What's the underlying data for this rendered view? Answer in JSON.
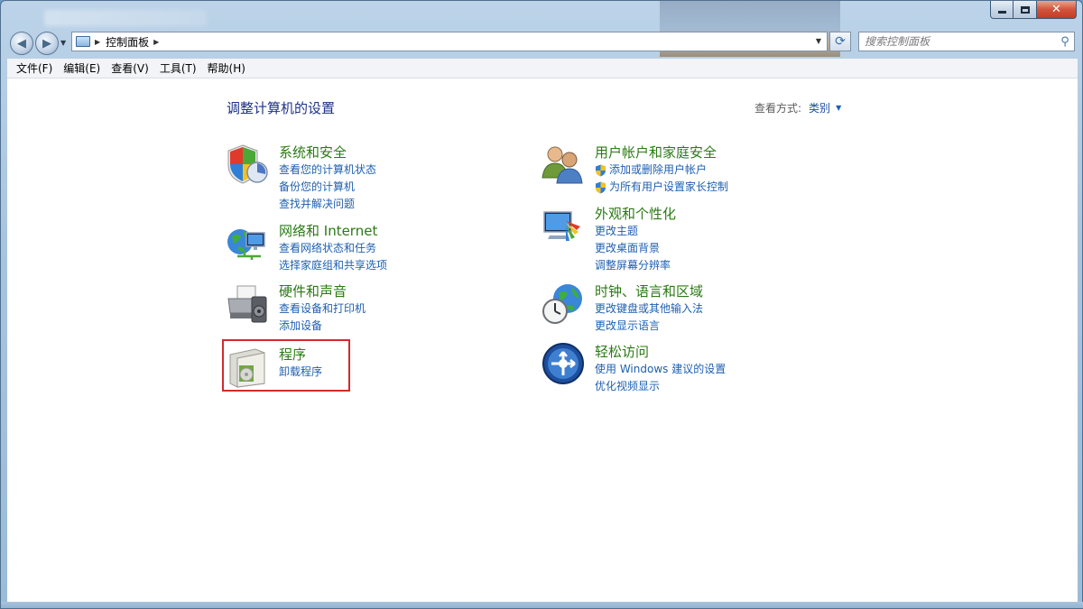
{
  "window": {
    "caption": {
      "minimize": "minimize",
      "maximize": "maximize",
      "close": "close"
    }
  },
  "nav": {
    "address": {
      "segment": "控制面板"
    },
    "search": {
      "placeholder": "搜索控制面板"
    }
  },
  "menu": [
    "文件(F)",
    "编辑(E)",
    "查看(V)",
    "工具(T)",
    "帮助(H)"
  ],
  "content": {
    "page_title": "调整计算机的设置",
    "view_by_label": "查看方式:",
    "view_by_value": "类别"
  },
  "categories": {
    "system_security": {
      "title": "系统和安全",
      "links": [
        "查看您的计算机状态",
        "备份您的计算机",
        "查找并解决问题"
      ]
    },
    "network": {
      "title": "网络和 Internet",
      "links": [
        "查看网络状态和任务",
        "选择家庭组和共享选项"
      ]
    },
    "hardware": {
      "title": "硬件和声音",
      "links": [
        "查看设备和打印机",
        "添加设备"
      ]
    },
    "programs": {
      "title": "程序",
      "links": [
        "卸载程序"
      ]
    },
    "user_accounts": {
      "title": "用户帐户和家庭安全",
      "links": [
        "添加或删除用户帐户",
        "为所有用户设置家长控制"
      ]
    },
    "appearance": {
      "title": "外观和个性化",
      "links": [
        "更改主题",
        "更改桌面背景",
        "调整屏幕分辨率"
      ]
    },
    "clock_region": {
      "title": "时钟、语言和区域",
      "links": [
        "更改键盘或其他输入法",
        "更改显示语言"
      ]
    },
    "ease_access": {
      "title": "轻松访问",
      "links": [
        "使用 Windows 建议的设置",
        "优化视频显示"
      ]
    }
  },
  "colors": {
    "category_title": "#2b7a14",
    "link": "#1e5fb0",
    "page_title": "#1e3287",
    "highlight_box": "#d22b2b"
  },
  "icons": {
    "system_security": "shield-icon",
    "network": "network-globe-icon",
    "hardware": "printer-icon",
    "programs": "programs-box-icon",
    "user_accounts": "users-icon",
    "appearance": "monitor-palette-icon",
    "clock_region": "clock-globe-icon",
    "ease_access": "ease-of-access-icon"
  }
}
